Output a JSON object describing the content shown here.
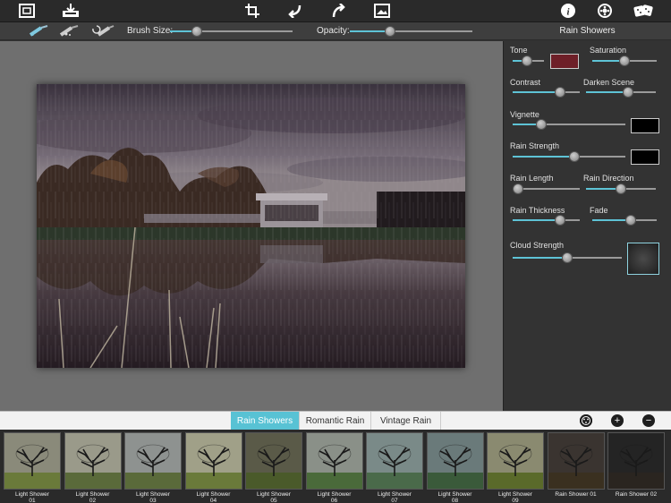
{
  "toolbar": {
    "icons": [
      "frame-icon",
      "save-icon",
      "crop-icon",
      "undo-icon",
      "redo-icon",
      "compare-icon",
      "info-icon",
      "settings-icon",
      "random-icon"
    ]
  },
  "brush_bar": {
    "brush_size_label": "Brush Size:",
    "brush_size_value": 0.22,
    "opacity_label": "Opacity:",
    "opacity_value": 0.33
  },
  "panel": {
    "title": "Rain Showers",
    "controls": {
      "tone": {
        "label": "Tone",
        "value": 0.45
      },
      "saturation": {
        "label": "Saturation",
        "value": 0.5
      },
      "contrast": {
        "label": "Contrast",
        "value": 0.7
      },
      "darken_scene": {
        "label": "Darken Scene",
        "value": 0.6
      },
      "vignette": {
        "label": "Vignette",
        "value": 0.25
      },
      "rain_strength": {
        "label": "Rain Strength",
        "value": 0.55
      },
      "rain_length": {
        "label": "Rain Length",
        "value": 0.08
      },
      "rain_direction": {
        "label": "Rain Direction",
        "value": 0.5
      },
      "rain_thickness": {
        "label": "Rain Thickness",
        "value": 0.7
      },
      "fade": {
        "label": "Fade",
        "value": 0.6
      },
      "cloud_strength": {
        "label": "Cloud Strength",
        "value": 0.5
      }
    },
    "colors": {
      "tone_swatch": "#6e1f28",
      "vignette_swatch": "#000000",
      "rain_swatch": "#000000"
    }
  },
  "tabs": [
    "Rain Showers",
    "Romantic Rain",
    "Vintage Rain"
  ],
  "active_tab": "Rain Showers",
  "thumbnails": [
    "Light Shower\n01",
    "Light Shower\n02",
    "Light Shower\n03",
    "Light Shower\n04",
    "Light Shower\n05",
    "Light Shower\n06",
    "Light Shower\n07",
    "Light Shower\n08",
    "Light Shower\n09",
    "Rain Shower 01",
    "Rain Shower 02"
  ],
  "accent_color": "#58c2d4"
}
